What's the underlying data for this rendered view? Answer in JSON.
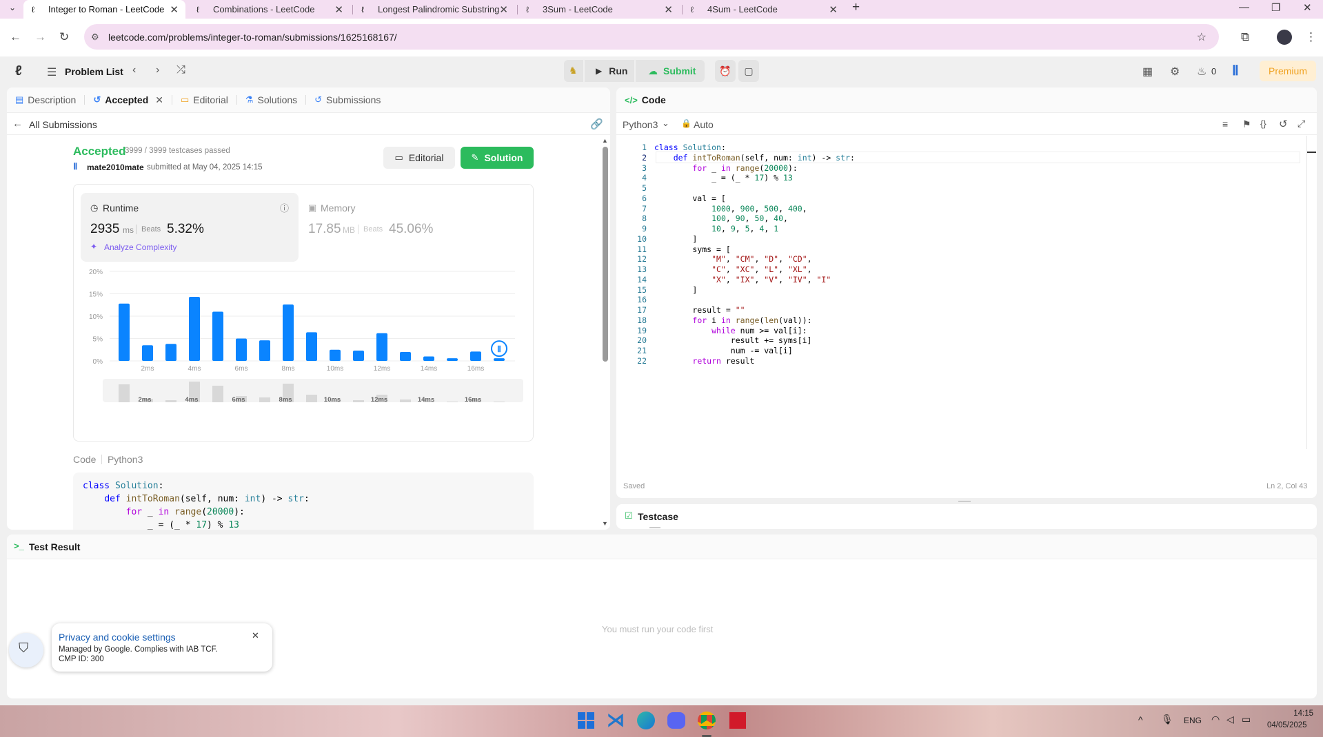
{
  "browser": {
    "tabs": [
      {
        "title": "Integer to Roman - LeetCode",
        "active": true
      },
      {
        "title": "Combinations - LeetCode",
        "active": false
      },
      {
        "title": "Longest Palindromic Substring",
        "active": false
      },
      {
        "title": "3Sum - LeetCode",
        "active": false
      },
      {
        "title": "4Sum - LeetCode",
        "active": false
      }
    ],
    "url": "leetcode.com/problems/integer-to-roman/submissions/1625168167/"
  },
  "header": {
    "problem_list": "Problem List",
    "run": "Run",
    "submit": "Submit",
    "streak": "0",
    "premium": "Premium"
  },
  "left_tabs": {
    "description": "Description",
    "accepted": "Accepted",
    "editorial": "Editorial",
    "solutions": "Solutions",
    "submissions": "Submissions"
  },
  "submission": {
    "back_label": "All Submissions",
    "status": "Accepted",
    "testcases": "3999 / 3999 testcases passed",
    "user": "mate2010mate",
    "submitted_at": "submitted at May 04, 2025 14:15",
    "editorial_btn": "Editorial",
    "solution_btn": "Solution",
    "runtime_label": "Runtime",
    "runtime_value": "2935",
    "runtime_unit": "ms",
    "beats_label": "Beats",
    "runtime_beats": "5.32%",
    "analyze": "Analyze Complexity",
    "memory_label": "Memory",
    "memory_value": "17.85",
    "memory_unit": "MB",
    "memory_beats": "45.06%",
    "code_label": "Code",
    "code_lang": "Python3"
  },
  "chart_data": {
    "type": "bar",
    "y_ticks": [
      "20%",
      "15%",
      "10%",
      "5%",
      "0%"
    ],
    "x_ticks": [
      "2ms",
      "4ms",
      "6ms",
      "8ms",
      "10ms",
      "12ms",
      "14ms",
      "16ms"
    ],
    "ylim": [
      0,
      20
    ],
    "values": [
      12.8,
      3.5,
      3.8,
      14.3,
      11,
      5,
      4.6,
      12.6,
      6.4,
      2.5,
      2.3,
      6.2,
      2,
      1,
      0.6,
      2.1,
      0.6
    ],
    "mini_values": [
      26,
      5,
      3,
      30,
      24,
      9,
      7,
      27,
      11,
      4,
      3,
      11,
      4,
      2,
      1,
      4,
      1
    ],
    "mini_ticks": [
      "2ms",
      "4ms",
      "6ms",
      "8ms",
      "10ms",
      "12ms",
      "14ms",
      "16ms"
    ]
  },
  "preview_code": [
    "class Solution:",
    "    def intToRoman(self, num: int) -> str:",
    "        for _ in range(20000):",
    "            _ = (_ * 17) % 13"
  ],
  "editor": {
    "title": "Code",
    "language": "Python3",
    "mode": "Auto",
    "saved": "Saved",
    "cursor": "Ln 2, Col 43",
    "lines": [
      "class Solution:",
      "    def intToRoman(self, num: int) -> str:",
      "        for _ in range(20000):",
      "            _ = (_ * 17) % 13",
      "",
      "        val = [",
      "            1000, 900, 500, 400,",
      "            100, 90, 50, 40,",
      "            10, 9, 5, 4, 1",
      "        ]",
      "        syms = [",
      "            \"M\", \"CM\", \"D\", \"CD\",",
      "            \"C\", \"XC\", \"L\", \"XL\",",
      "            \"X\", \"IX\", \"V\", \"IV\", \"I\"",
      "        ]",
      "",
      "        result = \"\"",
      "        for i in range(len(val)):",
      "            while num >= val[i]:",
      "                result += syms[i]",
      "                num -= val[i]",
      "        return result"
    ]
  },
  "testcase": {
    "title": "Testcase"
  },
  "test_result": {
    "title": "Test Result",
    "empty": "You must run your code first"
  },
  "cookie": {
    "title": "Privacy and cookie settings",
    "line1": "Managed by Google. Complies with IAB TCF.",
    "line2": "CMP ID: 300"
  },
  "taskbar": {
    "lang": "ENG",
    "time": "14:15",
    "date": "04/05/2025"
  }
}
